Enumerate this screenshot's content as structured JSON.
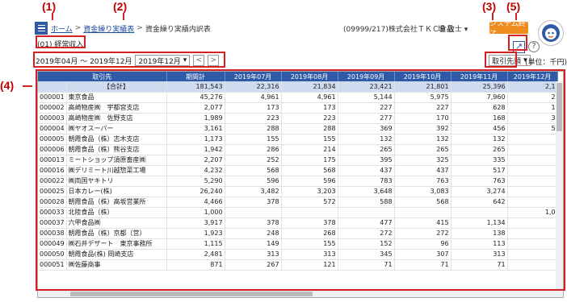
{
  "callouts": [
    "(1)",
    "(2)",
    "(3)",
    "(5)",
    "(4)"
  ],
  "breadcrumb": [
    "ホーム",
    "資金繰り実績表",
    "資金繰り実績内訳表"
  ],
  "company": "(09999/217)株式会社ＴＫＣ食品",
  "user": "堤 敬士",
  "end_button": "システム終了",
  "subtitle": "(01) 経常収入",
  "period": {
    "range": "2019年04月 ～ 2019年12月",
    "month": "2019年12月"
  },
  "sort_label": "取引先順",
  "unit_label": "(単位：千円)",
  "table": {
    "headers": [
      "取引先",
      "期間計",
      "2019年07月",
      "2019年08月",
      "2019年09月",
      "2019年10月",
      "2019年11月",
      "2019年12月"
    ],
    "rows": [
      {
        "code": "",
        "name": "【合計】",
        "total": "181,543",
        "m07": "22,316",
        "m08": "21,834",
        "m09": "23,421",
        "m10": "21,801",
        "m11": "25,396",
        "m12": "2,1"
      },
      {
        "code": "000001",
        "name": "東京食品",
        "total": "45,276",
        "m07": "4,961",
        "m08": "4,961",
        "m09": "5,144",
        "m10": "5,975",
        "m11": "7,960",
        "m12": "2"
      },
      {
        "code": "000002",
        "name": "高崎物産㈱　宇都宮支店",
        "total": "2,077",
        "m07": "173",
        "m08": "173",
        "m09": "227",
        "m10": "227",
        "m11": "628",
        "m12": "1"
      },
      {
        "code": "000003",
        "name": "高崎物産㈱　佐野支店",
        "total": "1,989",
        "m07": "223",
        "m08": "223",
        "m09": "277",
        "m10": "170",
        "m11": "168",
        "m12": "3"
      },
      {
        "code": "000004",
        "name": "㈱ヤオスーパー",
        "total": "3,161",
        "m07": "288",
        "m08": "288",
        "m09": "369",
        "m10": "392",
        "m11": "456",
        "m12": "5"
      },
      {
        "code": "000005",
        "name": "朝霞食品（株）志木支店",
        "total": "1,173",
        "m07": "155",
        "m08": "155",
        "m09": "132",
        "m10": "132",
        "m11": "132",
        "m12": ""
      },
      {
        "code": "000006",
        "name": "朝霞食品（株）熊谷支店",
        "total": "1,942",
        "m07": "286",
        "m08": "214",
        "m09": "265",
        "m10": "265",
        "m11": "265",
        "m12": ""
      },
      {
        "code": "000013",
        "name": "ミートショップ須原畜産㈱",
        "total": "2,207",
        "m07": "252",
        "m08": "175",
        "m09": "395",
        "m10": "325",
        "m11": "335",
        "m12": ""
      },
      {
        "code": "000016",
        "name": "㈱デリミート川越惣菜工場",
        "total": "4,232",
        "m07": "568",
        "m08": "568",
        "m09": "437",
        "m10": "437",
        "m11": "517",
        "m12": ""
      },
      {
        "code": "000022",
        "name": "㈱両国ヤキトリ",
        "total": "5,290",
        "m07": "596",
        "m08": "596",
        "m09": "783",
        "m10": "763",
        "m11": "763",
        "m12": ""
      },
      {
        "code": "000025",
        "name": "日本カレー(株)",
        "total": "26,240",
        "m07": "3,482",
        "m08": "3,203",
        "m09": "3,648",
        "m10": "3,083",
        "m11": "3,274",
        "m12": ""
      },
      {
        "code": "000028",
        "name": "朝霞食品（株）高坂営業所",
        "total": "4,466",
        "m07": "378",
        "m08": "572",
        "m09": "588",
        "m10": "568",
        "m11": "642",
        "m12": ""
      },
      {
        "code": "000033",
        "name": "北陸食品（株）",
        "total": "1,000",
        "m07": "",
        "m08": "",
        "m09": "",
        "m10": "",
        "m11": "",
        "m12": "1,0"
      },
      {
        "code": "000037",
        "name": "六甲食品㈱",
        "total": "3,917",
        "m07": "378",
        "m08": "378",
        "m09": "477",
        "m10": "415",
        "m11": "1,134",
        "m12": ""
      },
      {
        "code": "000038",
        "name": "朝霞食品（株）京都（営）",
        "total": "1,923",
        "m07": "248",
        "m08": "268",
        "m09": "272",
        "m10": "272",
        "m11": "138",
        "m12": ""
      },
      {
        "code": "000049",
        "name": "㈱石井デザート　東京事務所",
        "total": "1,115",
        "m07": "149",
        "m08": "155",
        "m09": "152",
        "m10": "96",
        "m11": "113",
        "m12": ""
      },
      {
        "code": "000050",
        "name": "朝霞食品(株) 岡崎支店",
        "total": "2,481",
        "m07": "313",
        "m08": "313",
        "m09": "345",
        "m10": "307",
        "m11": "313",
        "m12": ""
      },
      {
        "code": "000051",
        "name": "㈱佐藤商事",
        "total": "871",
        "m07": "267",
        "m08": "121",
        "m09": "71",
        "m10": "71",
        "m11": "71",
        "m12": ""
      }
    ]
  }
}
